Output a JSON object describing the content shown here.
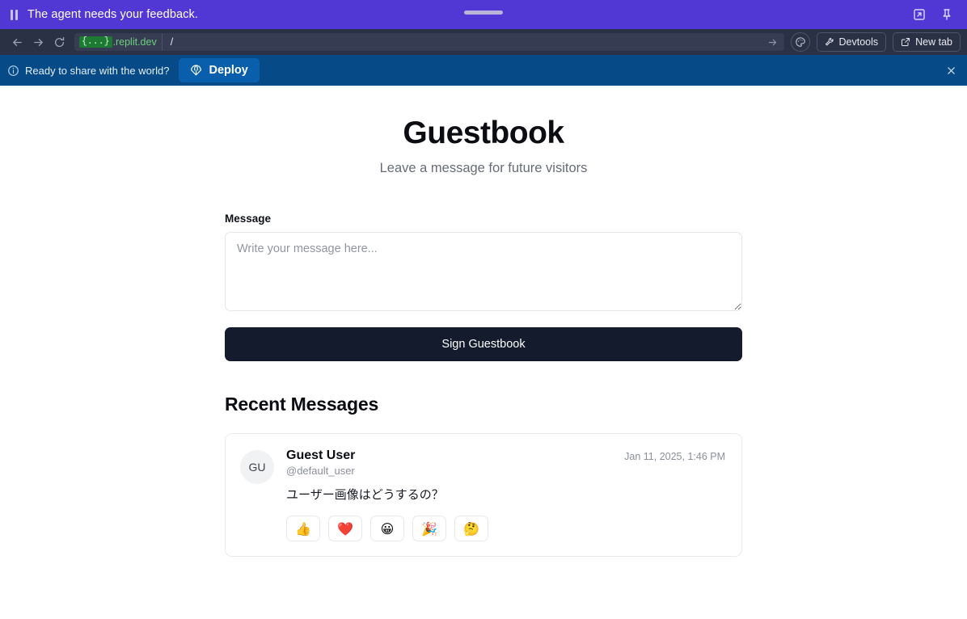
{
  "agent_bar": {
    "message": "The agent needs your feedback.",
    "pause_icon": "pause-icon",
    "drag_handle": "drag-handle",
    "popout_icon": "open-in-new-icon",
    "pin_icon": "pin-icon",
    "background": "#5138d4"
  },
  "browser_bar": {
    "back_icon": "back-arrow-icon",
    "forward_icon": "forward-arrow-icon",
    "reload_icon": "reload-icon",
    "url_badge": "{...}",
    "url_host": ".replit.dev",
    "url_path": "/",
    "go_icon": "go-arrow-icon",
    "palette_icon": "palette-icon",
    "devtools_label": "Devtools",
    "devtools_icon": "wrench-icon",
    "newtab_label": "New tab",
    "newtab_icon": "external-link-icon",
    "background": "#2b3145"
  },
  "deploy_banner": {
    "info_icon": "info-icon",
    "text": "Ready to share with the world?",
    "deploy_label": "Deploy",
    "deploy_icon": "parachute-icon",
    "close_icon": "close-icon",
    "background": "#064a87",
    "button_color": "#0a5fad"
  },
  "page": {
    "title": "Guestbook",
    "subtitle": "Leave a message for future visitors",
    "form": {
      "label": "Message",
      "placeholder": "Write your message here...",
      "value": "",
      "submit_label": "Sign Guestbook",
      "submit_color": "#141b2d"
    },
    "recent": {
      "heading": "Recent Messages",
      "messages": [
        {
          "avatar_initials": "GU",
          "author": "Guest User",
          "handle": "@default_user",
          "timestamp": "Jan 11, 2025, 1:46 PM",
          "text": "ユーザー画像はどうするの？",
          "reactions": [
            {
              "emoji": "👍",
              "name": "reaction-thumbs-up"
            },
            {
              "emoji": "❤️",
              "name": "reaction-heart"
            },
            {
              "emoji": "😀",
              "name": "reaction-grinning"
            },
            {
              "emoji": "🎉",
              "name": "reaction-party-popper"
            },
            {
              "emoji": "🤔",
              "name": "reaction-thinking"
            }
          ]
        }
      ]
    }
  }
}
